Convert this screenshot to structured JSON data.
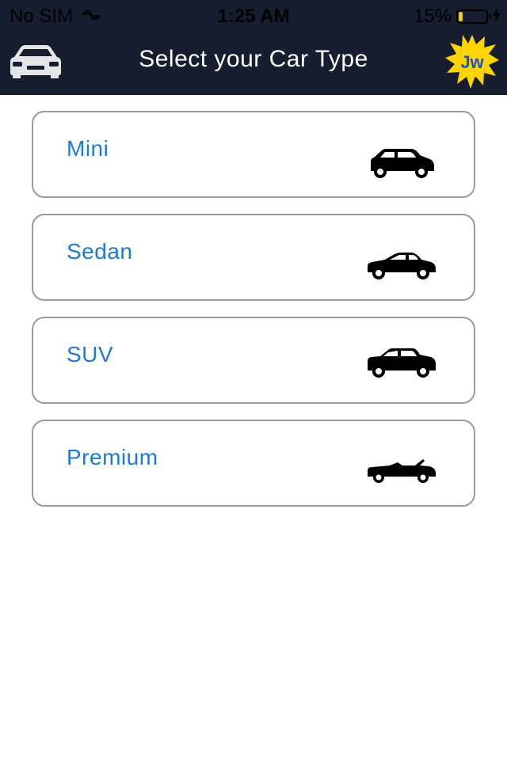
{
  "status_bar": {
    "carrier": "No SIM",
    "time": "1:25 AM",
    "battery_percent": "15%",
    "battery_level": 0.15,
    "colors": {
      "battery_fill": "#f5d000"
    }
  },
  "header": {
    "title": "Select your Car Type",
    "left_icon": "car-icon",
    "logo_text": "Jw",
    "colors": {
      "background": "#151d2f",
      "logo_splash": "#ffd400"
    }
  },
  "car_types": [
    {
      "label": "Mini",
      "icon": "hatchback-icon"
    },
    {
      "label": "Sedan",
      "icon": "sedan-icon"
    },
    {
      "label": "SUV",
      "icon": "suv-icon"
    },
    {
      "label": "Premium",
      "icon": "convertible-icon"
    }
  ],
  "colors": {
    "accent": "#1f7ad6",
    "card_border": "#9a9a9a"
  }
}
